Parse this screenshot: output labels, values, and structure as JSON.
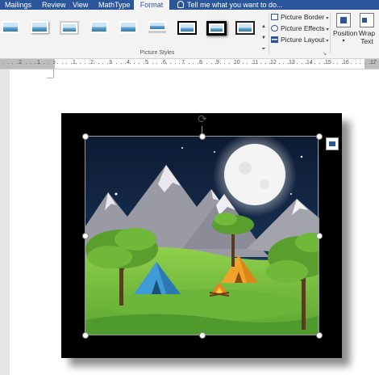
{
  "tabs": [
    "Mailings",
    "Review",
    "View",
    "MathType",
    "Format"
  ],
  "active_tab": "Format",
  "tell_me": "Tell me what you want to do...",
  "picture_styles": {
    "label": "Picture Styles",
    "gallery_count": 9
  },
  "commands": {
    "border": "Picture Border",
    "effects": "Picture Effects",
    "layout": "Picture Layout"
  },
  "arrange": {
    "position": "Position",
    "wrap_line1": "Wrap",
    "wrap_line2": "Text"
  },
  "ruler": {
    "numbers": [
      "2",
      "1",
      "1",
      "2",
      "3",
      "4",
      "5",
      "6",
      "7",
      "8",
      "9",
      "10",
      "11",
      "12",
      "13",
      "14",
      "15",
      "16",
      "17"
    ]
  },
  "colors": {
    "accent": "#2b579a",
    "ribbon": "#f3f3f3",
    "page": "#ffffff",
    "canvas": "#e6e6e6"
  },
  "picture": {
    "description_icon": "camping-night-illustration"
  }
}
